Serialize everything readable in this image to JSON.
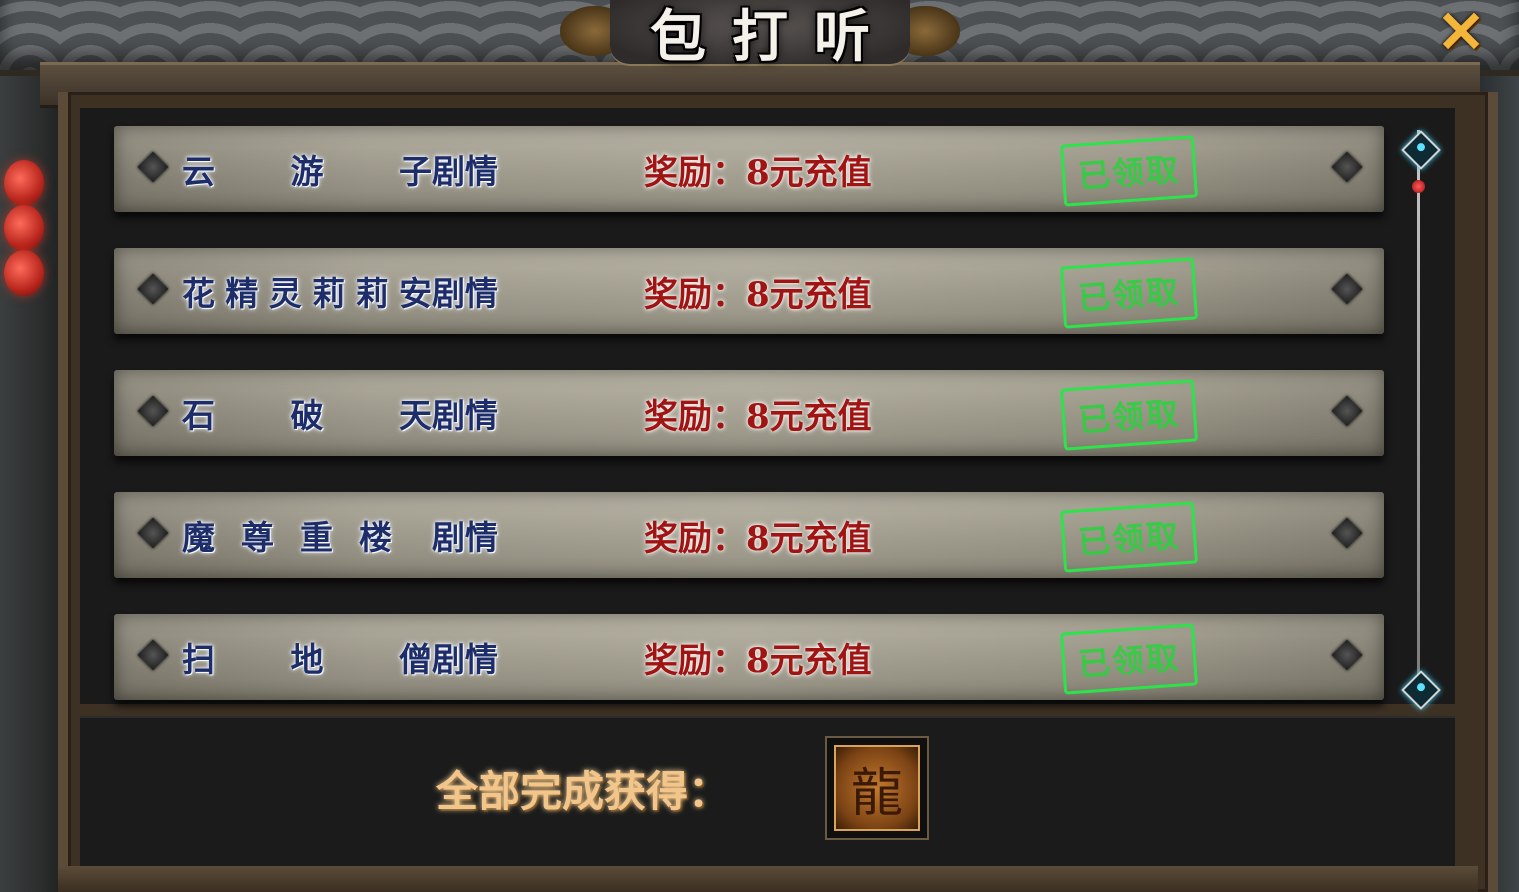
{
  "title": "包打听",
  "close_icon": "close-x-icon",
  "rows": [
    {
      "name_chars": [
        "云",
        "游",
        "子"
      ],
      "story": "剧情",
      "reward": "奖励：8元充值",
      "status": "已领取"
    },
    {
      "name_chars": [
        "花",
        "精",
        "灵",
        "莉",
        "莉",
        "安"
      ],
      "story": "剧情",
      "reward": "奖励：8元充值",
      "status": "已领取"
    },
    {
      "name_chars": [
        "石",
        "破",
        "天"
      ],
      "story": "剧情",
      "reward": "奖励：8元充值",
      "status": "已领取"
    },
    {
      "name_chars": [
        "魔",
        "尊",
        "重",
        "楼"
      ],
      "story": "剧情",
      "reward": "奖励：8元充值",
      "status": "已领取"
    },
    {
      "name_chars": [
        "扫",
        "地",
        "僧"
      ],
      "story": "剧情",
      "reward": "奖励：8元充值",
      "status": "已领取"
    }
  ],
  "completion_label": "全部完成获得：",
  "completion_reward_icon": "dragon-emblem-icon",
  "colors": {
    "name_text": "#1c2d6a",
    "reward_text": "#a11414",
    "stamp": "#2ee24a",
    "completion_text": "#f2c58a",
    "close": "#f3b53a"
  }
}
